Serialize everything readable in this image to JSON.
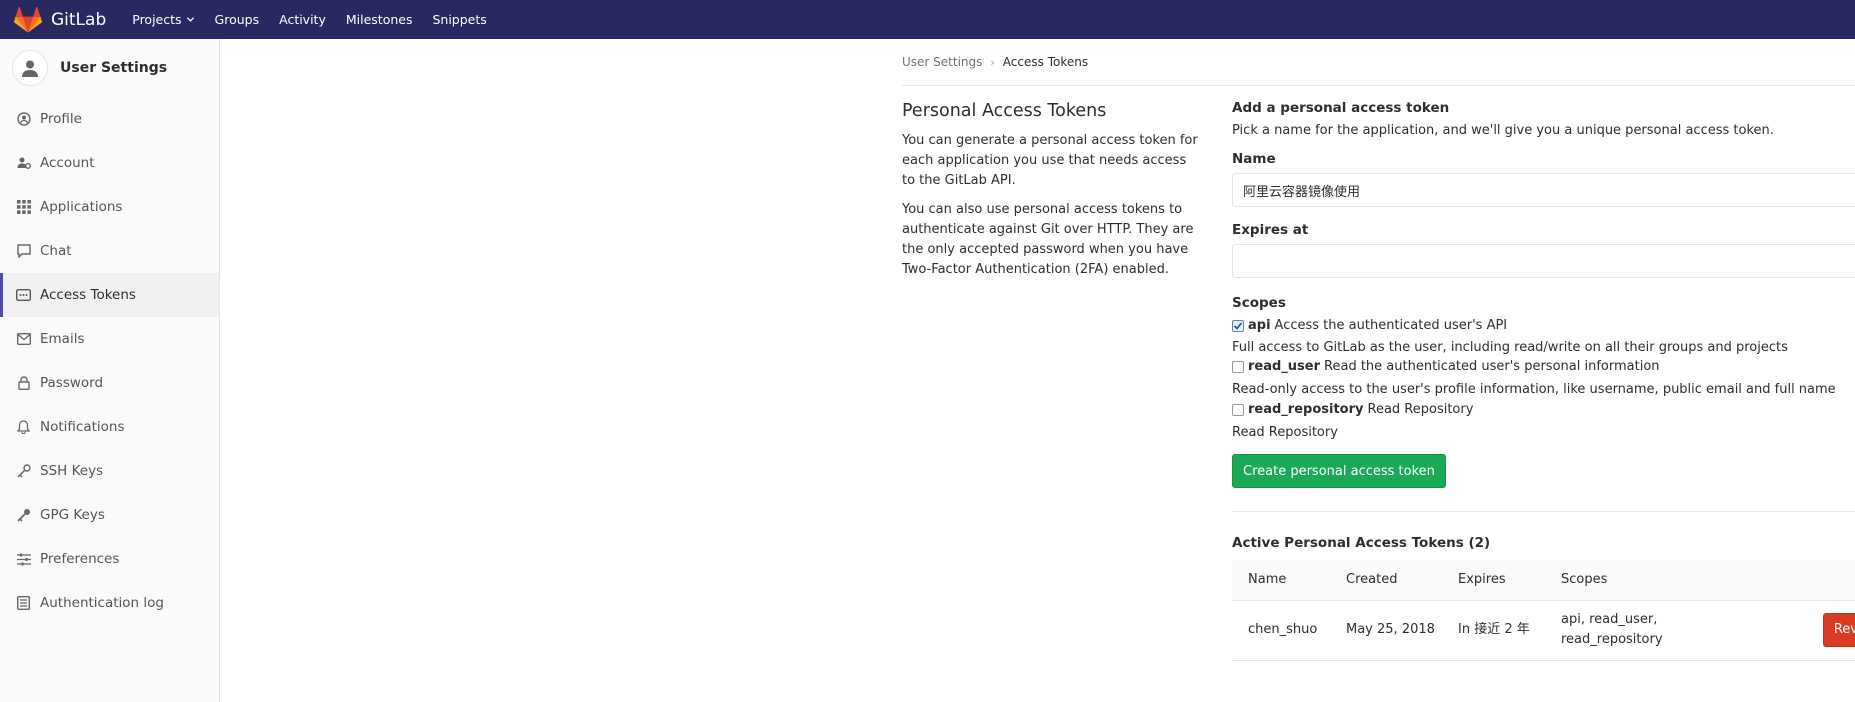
{
  "app": {
    "name": "GitLab"
  },
  "navbar": {
    "links": [
      "Projects",
      "Groups",
      "Activity",
      "Milestones",
      "Snippets"
    ]
  },
  "sidebar": {
    "title": "User Settings",
    "items": [
      {
        "label": "Profile",
        "icon": "profile-icon"
      },
      {
        "label": "Account",
        "icon": "account-icon"
      },
      {
        "label": "Applications",
        "icon": "applications-icon"
      },
      {
        "label": "Chat",
        "icon": "chat-icon"
      },
      {
        "label": "Access Tokens",
        "icon": "access-tokens-icon",
        "active": true
      },
      {
        "label": "Emails",
        "icon": "emails-icon"
      },
      {
        "label": "Password",
        "icon": "lock-icon"
      },
      {
        "label": "Notifications",
        "icon": "bell-icon"
      },
      {
        "label": "SSH Keys",
        "icon": "key-icon"
      },
      {
        "label": "GPG Keys",
        "icon": "key-icon"
      },
      {
        "label": "Preferences",
        "icon": "sliders-icon"
      },
      {
        "label": "Authentication log",
        "icon": "log-icon"
      }
    ]
  },
  "breadcrumb": {
    "parent": "User Settings",
    "current": "Access Tokens"
  },
  "intro": {
    "title": "Personal Access Tokens",
    "p1": "You can generate a personal access token for each application you use that needs access to the GitLab API.",
    "p2": "You can also use personal access tokens to authenticate against Git over HTTP. They are the only accepted password when you have Two-Factor Authentication (2FA) enabled."
  },
  "form": {
    "heading": "Add a personal access token",
    "hint": "Pick a name for the application, and we'll give you a unique personal access token.",
    "name_label": "Name",
    "name_value": "阿里云容器镜像使用",
    "expires_label": "Expires at",
    "expires_value": "",
    "scopes_label": "Scopes",
    "scopes": [
      {
        "name": "api",
        "short": "Access the authenticated user's API",
        "desc": "Full access to GitLab as the user, including read/write on all their groups and projects",
        "checked": true
      },
      {
        "name": "read_user",
        "short": "Read the authenticated user's personal information",
        "desc": "Read-only access to the user's profile information, like username, public email and full name",
        "checked": false
      },
      {
        "name": "read_repository",
        "short": "Read Repository",
        "desc": "Read Repository",
        "checked": false
      }
    ],
    "submit_label": "Create personal access token"
  },
  "active_tokens": {
    "heading": "Active Personal Access Tokens (2)",
    "columns": [
      "Name",
      "Created",
      "Expires",
      "Scopes"
    ],
    "rows": [
      {
        "name": "chen_shuo",
        "created": "May 25, 2018",
        "expires": "In 接近 2 年",
        "scopes": "api, read_user, read_repository",
        "action": "Revoke"
      }
    ]
  },
  "colors": {
    "navbar": "#292961",
    "create_button": "#1aaa55",
    "revoke_button": "#db3b21",
    "sidebar_active_indicator": "#4b4ba3"
  }
}
